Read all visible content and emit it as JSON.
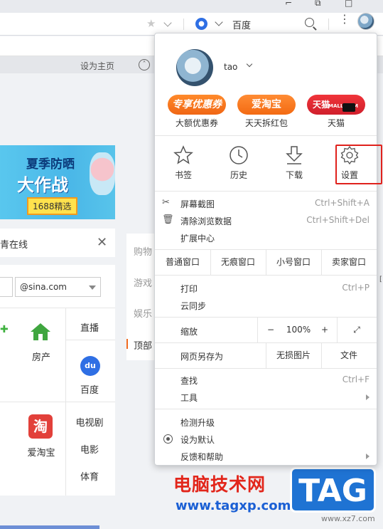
{
  "browser": {
    "search_engine": "百度",
    "home_button": "设为主页"
  },
  "page": {
    "banner": {
      "line1": "夏季防晒",
      "line2": "大作战",
      "tag": "1688精选"
    },
    "search_tip": "青在线",
    "mail_domain": "@sina.com",
    "tiles": [
      "房产",
      "直播",
      "百度",
      "爱淘宝",
      "电视剧",
      "电影",
      "体育"
    ],
    "side_tabs": [
      "购物",
      "游戏",
      "娱乐",
      "顶部"
    ]
  },
  "menu": {
    "user": {
      "name": "tao"
    },
    "promos": [
      {
        "badge": "专享优惠券",
        "label": "大额优惠券"
      },
      {
        "badge": "爱淘宝",
        "label": "天天拆红包"
      },
      {
        "badge": "天猫",
        "badge_small": "TMALL.COM",
        "label": "天猫"
      }
    ],
    "tools": [
      {
        "label": "书签",
        "icon": "star-icon"
      },
      {
        "label": "历史",
        "icon": "clock-icon"
      },
      {
        "label": "下载",
        "icon": "download-icon"
      },
      {
        "label": "设置",
        "icon": "gear-icon"
      }
    ],
    "items": {
      "screenshot": {
        "label": "屏幕截图",
        "shortcut": "Ctrl+Shift+A"
      },
      "clear_data": {
        "label": "清除浏览数据",
        "shortcut": "Ctrl+Shift+Del"
      },
      "extensions": {
        "label": "扩展中心"
      },
      "print": {
        "label": "打印",
        "shortcut": "Ctrl+P"
      },
      "sync": {
        "label": "云同步"
      },
      "find": {
        "label": "查找",
        "shortcut": "Ctrl+F"
      },
      "tools": {
        "label": "工具"
      },
      "update": {
        "label": "检测升级"
      },
      "default": {
        "label": "设为默认"
      },
      "feedback": {
        "label": "反馈和帮助"
      }
    },
    "windows": [
      "普通窗口",
      "无痕窗口",
      "小号窗口",
      "卖家窗口"
    ],
    "zoom": {
      "label": "缩放",
      "minus": "−",
      "value": "100%",
      "plus": "+"
    },
    "save_as": {
      "label": "网页另存为",
      "no_img": "无损图片",
      "file": "文件"
    }
  },
  "watermark": {
    "text": "电脑技术网",
    "url": "www.tagxp.com",
    "badge": "TAG",
    "small": "www.xz7.com"
  }
}
